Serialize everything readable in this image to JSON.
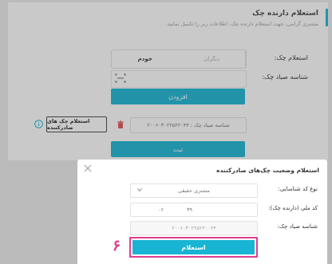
{
  "background_form": {
    "title": "استعلام دارنده چک",
    "subtitle": "مشتری گرامی، جهت استعلام دارنده چک، اطلاعات زیر را تکمیل نمایید.",
    "inquiry_label": "استعلام چک:",
    "owner_options": [
      "خودم",
      "دیگران"
    ],
    "sayad_label": "شناسه صیاد چک:",
    "add_button": "افزودن",
    "check_chip": "شناسه صیاد چک : ۲۰۰۶۰۳۰۲۲۵۲۲۰۴۴",
    "check_inquiry_button": "استعلام چک های صادرکننده",
    "submit_button": "ثبت"
  },
  "modal": {
    "title": "استعلام وضعیت چک‌های صادرکننده",
    "id_type_label": "نوع کد شناسایی:",
    "id_type_value": "مشتری حقیقی",
    "national_id_label": "کد ملی (دارنده چک):",
    "national_id_part1": "۳۹",
    "national_id_part2": "۰۶",
    "sayad_label": "شناسه صیاد چک:",
    "sayad_value": "۲۰۰۶۰۳۰۲۲۵۲۲۰۰۴۴",
    "inquiry_button": "استعلام",
    "step_number": "۶"
  },
  "colors": {
    "accent": "#18b4d3",
    "highlight": "#e23d8e"
  }
}
